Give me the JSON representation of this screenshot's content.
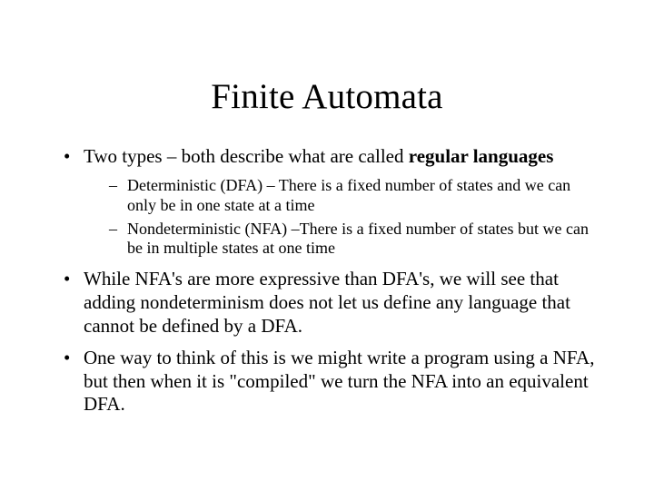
{
  "title": "Finite Automata",
  "bullets": {
    "b1_pre": "Two types – both describe what are called ",
    "b1_bold": "regular languages",
    "b1a": "Deterministic (DFA) – There is a fixed number of states and we can only be in one state at a time",
    "b1b": "Nondeterministic (NFA) –There is a fixed number of states but we can be in multiple states at one time",
    "b2": "While NFA's are more expressive than DFA's, we will see that adding nondeterminism does not let us define any language that cannot be defined by a DFA.",
    "b3": "One way to think of this is we might write a program using a NFA, but then when it is \"compiled\" we turn the NFA into an equivalent DFA."
  }
}
